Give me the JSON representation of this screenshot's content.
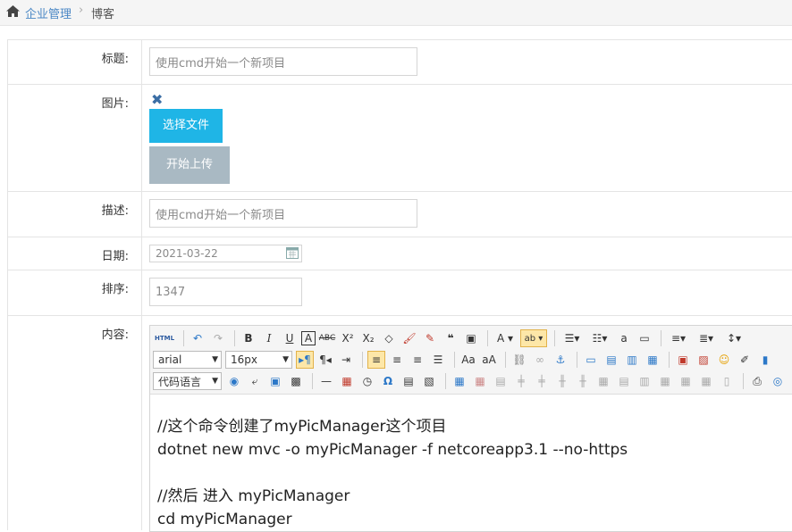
{
  "breadcrumb": {
    "home": "企业管理",
    "current": "博客"
  },
  "form": {
    "title_label": "标题:",
    "title_value": "使用cmd开始一个新项目",
    "image_label": "图片:",
    "choose_file": "选择文件",
    "start_upload": "开始上传",
    "desc_label": "描述:",
    "desc_value": "使用cmd开始一个新项目",
    "date_label": "日期:",
    "date_value": "2021-03-22",
    "order_label": "排序:",
    "order_value": "1347",
    "content_label": "内容:"
  },
  "editor": {
    "font_family": "arial",
    "font_size": "16px",
    "code_lang": "代码语言",
    "html_label": "HTML",
    "lines": [
      "//这个命令创建了myPicManager这个项目",
      "dotnet new mvc -o myPicManager -f netcoreapp3.1 --no-https",
      "",
      "//然后 进入 myPicManager",
      "cd myPicManager"
    ]
  }
}
